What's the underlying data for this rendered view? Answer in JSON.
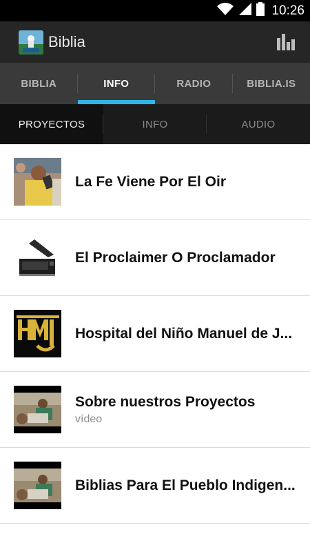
{
  "status_bar": {
    "time": "10:26",
    "icons": [
      "wifi-icon",
      "signal-icon",
      "battery-icon"
    ]
  },
  "action_bar": {
    "title": "Biblia",
    "logo_icon": "app-logo-icon",
    "action_icon": "bar-chart-icon"
  },
  "main_tabs": [
    {
      "label": "BIBLIA",
      "active": false
    },
    {
      "label": "INFO",
      "active": true
    },
    {
      "label": "RADIO",
      "active": false
    },
    {
      "label": "BIBLIA.IS",
      "active": false
    }
  ],
  "sub_tabs": [
    {
      "label": "PROYECTOS",
      "active": true
    },
    {
      "label": "INFO",
      "active": false
    },
    {
      "label": "AUDIO",
      "active": false
    }
  ],
  "items": [
    {
      "title": "La Fe Viene Por El Oir",
      "subtitle": "",
      "thumb": "boy-with-radio"
    },
    {
      "title": "El Proclaimer O Proclamador",
      "subtitle": "",
      "thumb": "proclaimer-device"
    },
    {
      "title": "Hospital del Niño Manuel de J...",
      "subtitle": "",
      "thumb": "hmj-logo"
    },
    {
      "title": "Sobre nuestros Proyectos",
      "subtitle": "vídeo",
      "thumb": "video-thumbnail"
    },
    {
      "title": "Biblias Para El Pueblo Indigen...",
      "subtitle": "",
      "thumb": "video-thumbnail"
    }
  ],
  "colors": {
    "accent": "#33b5e5",
    "action_bar": "#262626",
    "main_tabs": "#3a3a3a",
    "sub_tabs": "#1b1b1b"
  }
}
